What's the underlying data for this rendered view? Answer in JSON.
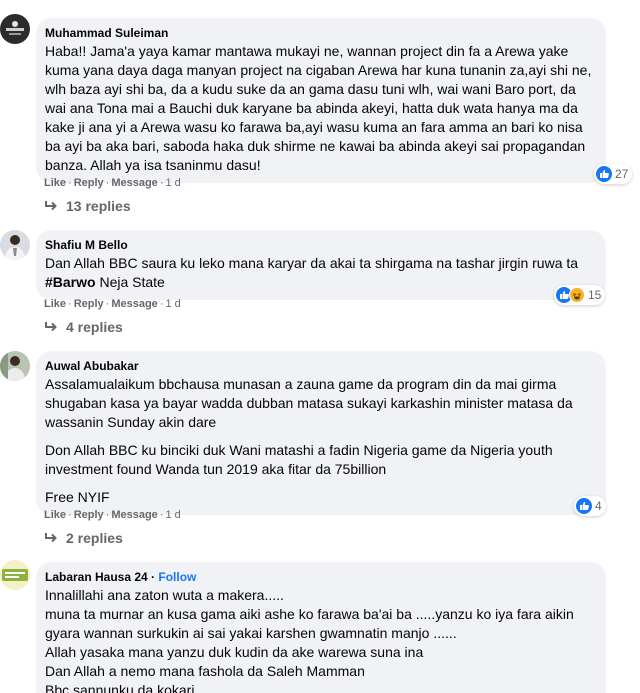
{
  "comments": [
    {
      "author": "Muhammad Suleiman",
      "paragraphs": [
        "Haba!! Jama'a yaya kamar mantawa mukayi ne, wannan project din fa a Arewa yake kuma yana daya daga manyan project na cigaban Arewa har kuna tunanin za,ayi shi ne, wlh baza ayi shi ba, da a kudu suke da an gama dasu tuni wlh, wai wani Baro port, da wai ana Tona mai a Bauchi duk karyane ba abinda akeyi, hatta duk wata hanya ma da kake ji ana yi a Arewa wasu ko farawa ba,ayi wasu kuma an fara amma an bari ko nisa ba ayi ba aka bari, saboda haka duk shirme ne kawai ba abinda akeyi sai propagandan banza. Allah ya isa tsaninmu dasu!"
      ],
      "actions": {
        "like": "Like",
        "reply": "Reply",
        "message": "Message",
        "time": "1 d"
      },
      "reactions": {
        "count": "27"
      },
      "replies": "13 replies"
    },
    {
      "author": "Shafiu M Bello",
      "text_before": "Dan Allah BBC saura ku leko mana karyar da akai ta shirgama na tashar jirgin ruwa ta ",
      "hashtag": "#Barwo",
      "text_after": " Neja State",
      "actions": {
        "like": "Like",
        "reply": "Reply",
        "message": "Message",
        "time": "1 d"
      },
      "reactions": {
        "count": "15"
      },
      "replies": "4 replies"
    },
    {
      "author": "Auwal Abubakar",
      "paragraphs": [
        "Assalamualaikum bbchausa munasan a zauna game da program din da mai girma shugaban kasa ya bayar wadda dubban matasa sukayi karkashin minister matasa da wassanin Sunday akin dare",
        "Don Allah BBC ku binciki duk Wani matashi a fadin Nigeria game da Nigeria youth investment found Wanda tun 2019 aka fitar da 75billion",
        "Free NYIF"
      ],
      "actions": {
        "like": "Like",
        "reply": "Reply",
        "message": "Message",
        "time": "1 d"
      },
      "reactions": {
        "count": "4"
      },
      "replies": "2 replies"
    },
    {
      "author": "Labaran Hausa 24",
      "follow": "Follow",
      "lines": [
        "Innalillahi ana zaton wuta a makera.....",
        "muna ta murnar an kusa gama aiki ashe ko farawa ba'ai ba .....yanzu ko iya fara aikin gyara wannan surkukin ai sai yakai karshen gwamnatin manjo ......",
        "Allah yasaka mana yanzu duk kudin da ake warewa suna ina",
        "Dan Allah a nemo mana fashola da Saleh Mamman",
        "Bbc sannunku da kokari"
      ]
    }
  ]
}
